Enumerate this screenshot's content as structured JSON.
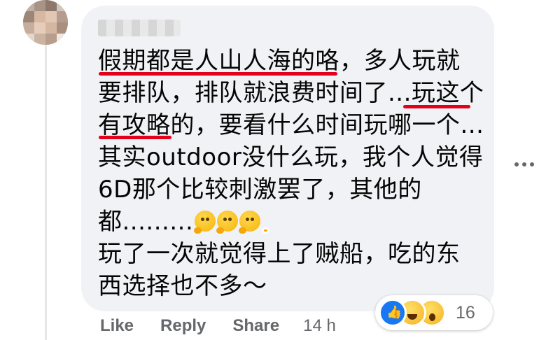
{
  "comment": {
    "lines": [
      "假期都是人山人海的咯，多人玩就",
      "要排队，排队就浪费时间了...玩这个",
      "有攻略的，要看什么时间玩哪一个...",
      "其实outdoor没什么玩，我个人觉得",
      "6D那个比较刺激罢了，其他的",
      "都.........",
      "玩了一次就觉得上了贼船，吃的东",
      "西选择也不多～"
    ]
  },
  "actions": {
    "like": "Like",
    "reply": "Reply",
    "share": "Share",
    "time": "14 h"
  },
  "reactions": {
    "icons": [
      "like-icon",
      "haha-icon",
      "wow-icon"
    ],
    "count": "16"
  },
  "colors": {
    "bubble": "#f0f2f5",
    "underline": "#e3001b",
    "meta": "#65676b"
  }
}
